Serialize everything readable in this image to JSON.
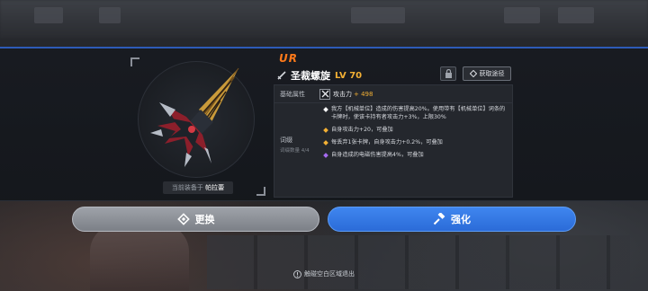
{
  "item": {
    "rarity": "UR",
    "name": "圣裁螺旋",
    "level": "LV 70",
    "equipped_prefix": "当前装备于",
    "equipped_by": "帕拉蕾"
  },
  "actions": {
    "source_label": "获取途径",
    "replace_label": "更换",
    "enhance_label": "强化"
  },
  "attributes": {
    "base_label": "基础属性",
    "attack_name": "攻击力",
    "attack_value": "+ 498",
    "affix_label": "词缀",
    "affix_count": "词缀数量 4/4",
    "affixes": [
      {
        "text": "我方【机械单位】造成的伤害提高20%。使用带有【机械单位】词条的卡牌时，使该卡持有者攻击力+3%，上限30%",
        "color": "#ffffff"
      },
      {
        "text": "自身攻击力+20，可叠加",
        "color": "#f3b034"
      },
      {
        "text": "每丢弃1张卡牌，自身攻击力+0.2%，可叠加",
        "color": "#f3b034"
      },
      {
        "text": "自身造成的电磁伤害提高4%，可叠加",
        "color": "#a56bf0"
      }
    ]
  },
  "footer": {
    "exit_hint": "触碰空白区域退出"
  },
  "colors": {
    "accent_blue": "#2d5bb8",
    "rarity_orange": "#ff7a1a",
    "value_gold": "#f3b034"
  }
}
